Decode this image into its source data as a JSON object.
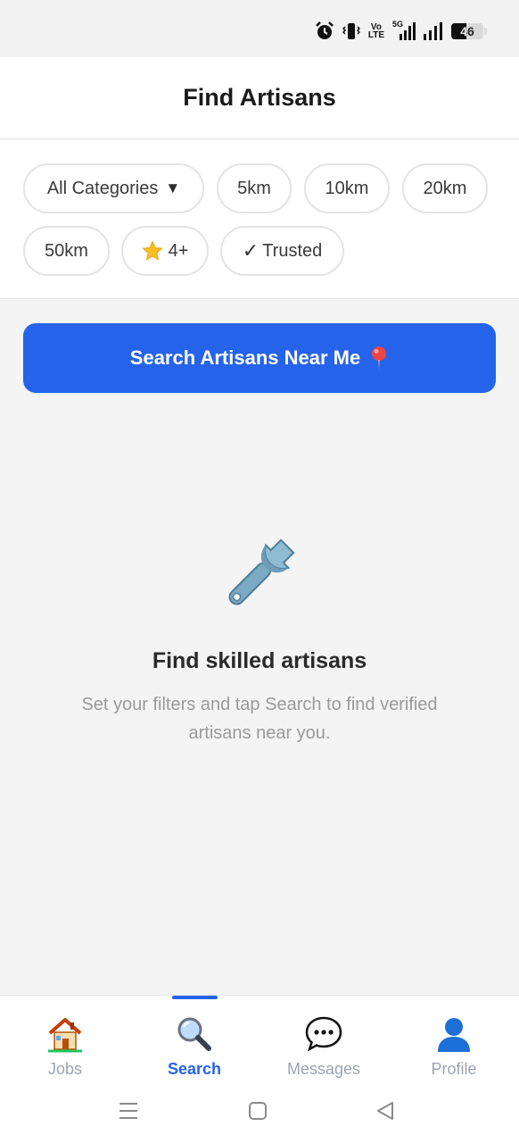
{
  "status_bar": {
    "lte_top": "Vo",
    "lte_bottom": "LTE",
    "net_label": "5G",
    "battery_level": 46,
    "battery_text": "46"
  },
  "header": {
    "title": "Find Artisans"
  },
  "filters": {
    "categories": "All Categories",
    "caret": "▼",
    "distances": [
      "5km",
      "10km",
      "20km",
      "50km"
    ],
    "rating": "4+",
    "trusted_check": "✓",
    "trusted": "Trusted"
  },
  "search_button": {
    "label": "Search Artisans Near Me"
  },
  "empty_state": {
    "title": "Find skilled artisans",
    "description": "Set your filters and tap Search to find verified artisans near you."
  },
  "bottom_nav": {
    "items": [
      {
        "label": "Jobs",
        "icon": "house-icon"
      },
      {
        "label": "Search",
        "icon": "magnifier-icon"
      },
      {
        "label": "Messages",
        "icon": "speech-bubble-icon"
      },
      {
        "label": "Profile",
        "icon": "user-icon"
      }
    ],
    "active_index": 1
  },
  "colors": {
    "accent": "#2563eb",
    "chip_border": "#e3e3e5",
    "muted_text": "#9a9a9a",
    "background": "#f4f4f5"
  }
}
